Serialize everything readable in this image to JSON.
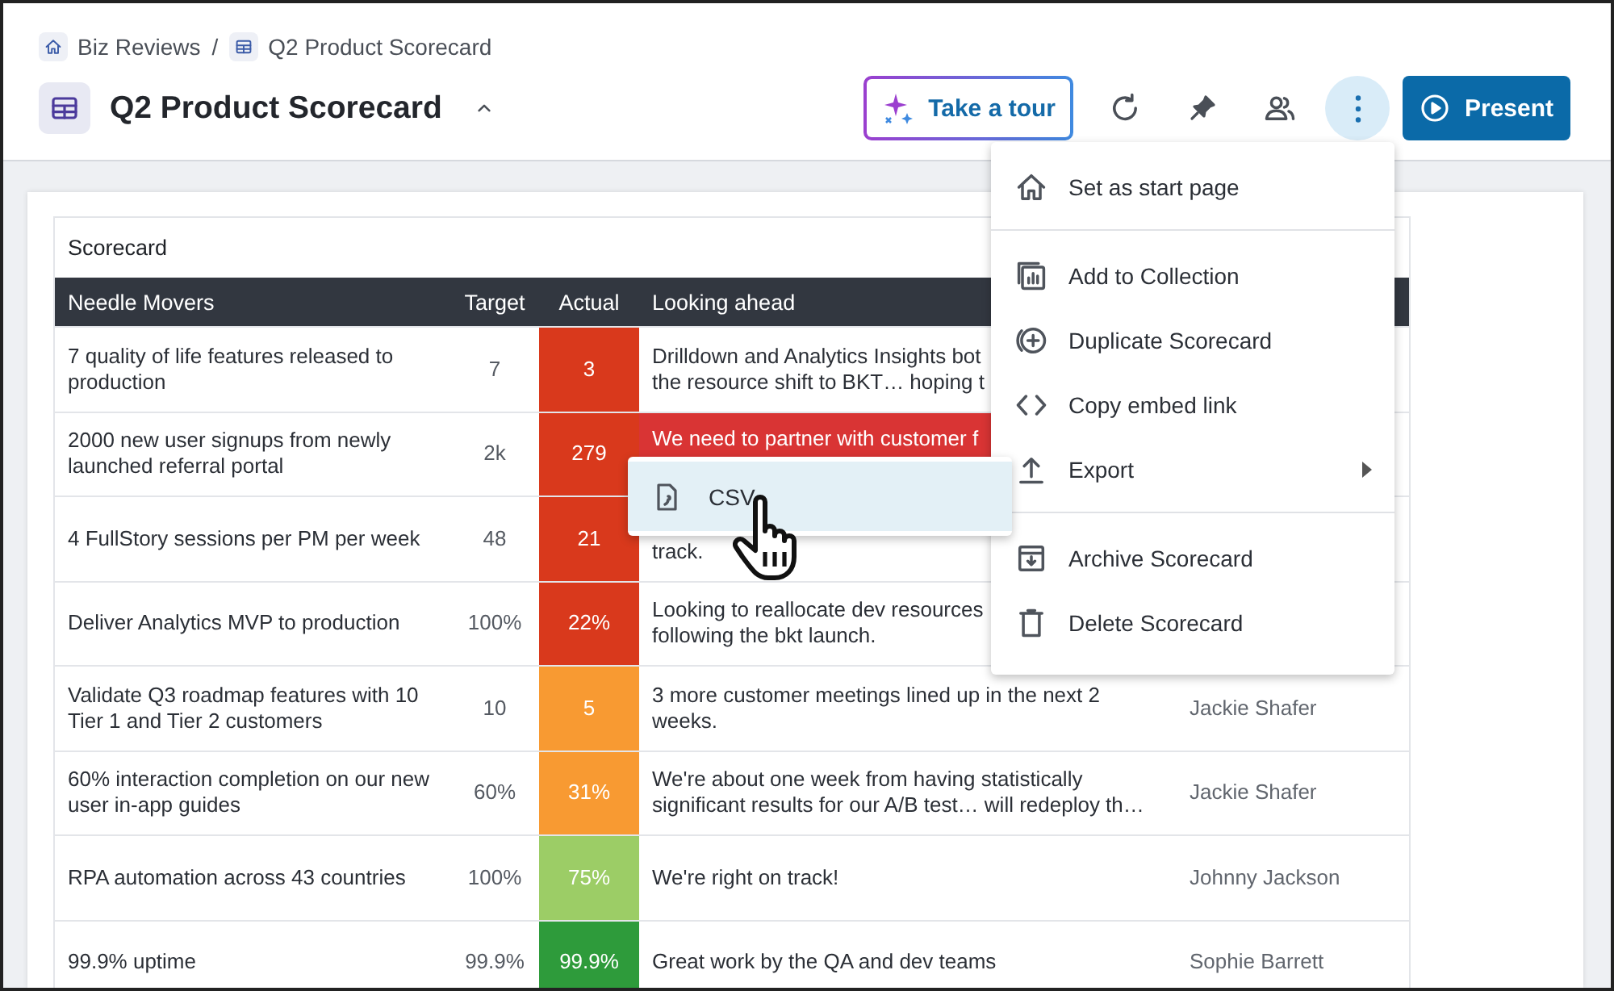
{
  "breadcrumb": {
    "items": [
      {
        "label": "Biz Reviews"
      },
      {
        "label": "Q2 Product Scorecard"
      }
    ],
    "separator": "/"
  },
  "title": "Q2 Product Scorecard",
  "toolbar": {
    "tour_button": "Take a tour",
    "more_menu_open": true,
    "present_button": "Present"
  },
  "table": {
    "caption": "Scorecard",
    "columns": [
      "Needle Movers",
      "Target",
      "Actual",
      "Looking ahead"
    ],
    "rows": [
      {
        "goal": "7 quality of life features released to production",
        "target": "7",
        "actual": "3",
        "color": "#d9391c",
        "looking_ahead": [
          "Drilldown and Analytics Insights bot",
          "the resource shift to BKT… hoping t"
        ]
      },
      {
        "goal": "2000 new user signups from newly launched referral portal",
        "target": "2k",
        "actual": "279",
        "color": "#d9391c",
        "looking_ahead": [
          "We need to partner with customer f"
        ],
        "highlight": {
          "color": "#d93434"
        }
      },
      {
        "goal": "4 FullStory sessions per PM per week",
        "target": "48",
        "actual": "21",
        "color": "#d9391c",
        "looking_ahead": [
          "track."
        ],
        "top_hidden": true
      },
      {
        "goal": "Deliver Analytics MVP to production",
        "target": "100%",
        "actual": "22%",
        "color": "#d9391c",
        "looking_ahead": [
          "Looking to reallocate dev resources",
          "following the bkt launch."
        ]
      },
      {
        "goal": "Validate Q3 roadmap features with 10 Tier 1 and Tier 2 customers",
        "target": "10",
        "actual": "5",
        "color": "#f89a32",
        "looking_ahead": [
          "3 more customer meetings lined up in the next 2",
          "weeks."
        ],
        "owner": "Jackie Shafer"
      },
      {
        "goal": "60% interaction completion on our new user in-app guides",
        "target": "60%",
        "actual": "31%",
        "color": "#f89a32",
        "looking_ahead": [
          "We're about one week from having statistically",
          "significant results for our A/B test… will redeploy th…"
        ],
        "owner": "Jackie Shafer"
      },
      {
        "goal": "RPA automation across 43 countries",
        "target": "100%",
        "actual": "75%",
        "color": "#9ccd66",
        "looking_ahead": [
          "We're right on track!"
        ],
        "owner": "Johnny Jackson"
      },
      {
        "goal": "99.9% uptime",
        "target": "99.9%",
        "actual": "99.9%",
        "color": "#2e9b3b",
        "looking_ahead": [
          "Great work by the QA and dev teams"
        ],
        "owner": "Sophie Barrett"
      }
    ]
  },
  "menu": {
    "groups": [
      [
        {
          "label": "Set as start page",
          "has_submenu": false
        }
      ],
      [
        {
          "label": "Add to Collection",
          "has_submenu": false
        },
        {
          "label": "Duplicate Scorecard",
          "has_submenu": false
        },
        {
          "label": "Copy embed link",
          "has_submenu": false
        },
        {
          "label": "Export",
          "has_submenu": true
        }
      ],
      [
        {
          "label": "Archive Scorecard",
          "has_submenu": false
        },
        {
          "label": "Delete Scorecard",
          "has_submenu": false
        }
      ]
    ]
  },
  "submenu": {
    "items": [
      {
        "label": "CSV",
        "hovered": true
      }
    ]
  }
}
